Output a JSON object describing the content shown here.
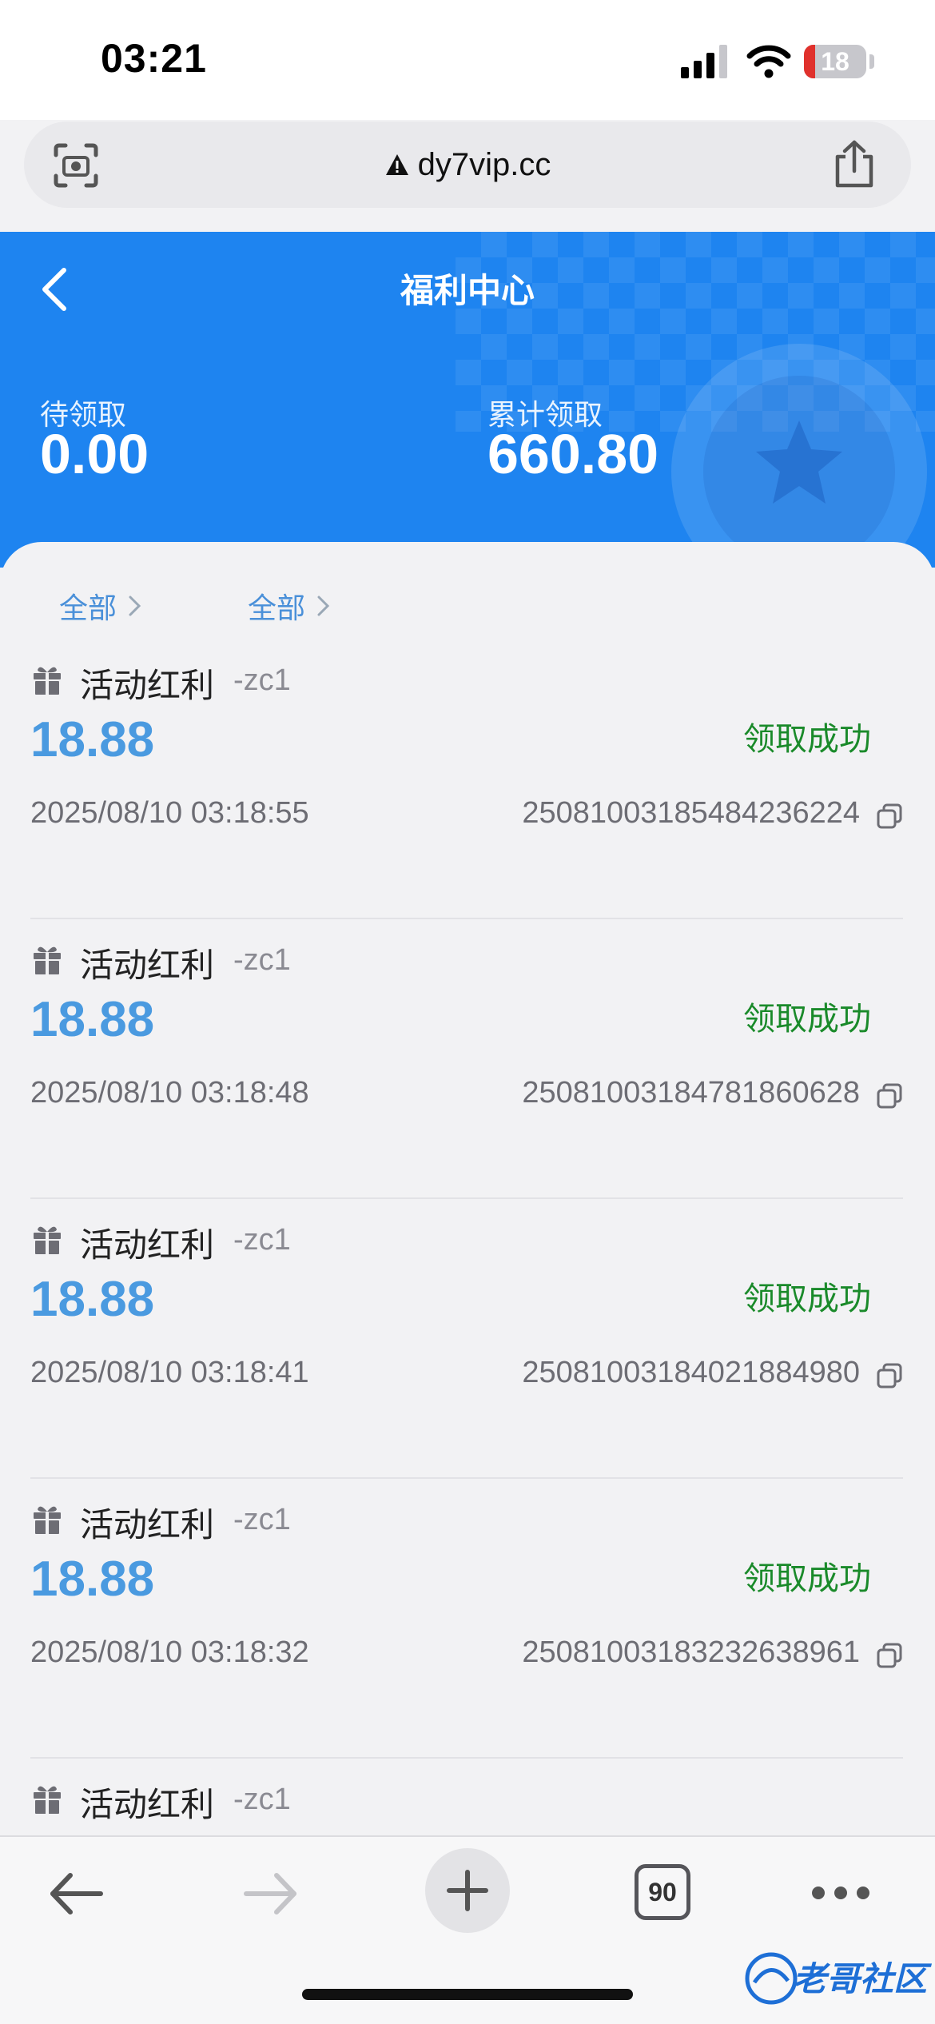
{
  "status_bar": {
    "time": "03:21",
    "battery_level": "18",
    "battery_fill_percent": 18,
    "icons": [
      "signal-icon",
      "wifi-icon",
      "battery-icon"
    ]
  },
  "browser": {
    "url": "dy7vip.cc",
    "icons": [
      "camera-search-icon",
      "warning-icon",
      "share-icon"
    ]
  },
  "header": {
    "title": "福利中心",
    "pending_label": "待领取",
    "pending_value": "0.00",
    "total_label": "累计领取",
    "total_value": "660.80",
    "accent_color": "#1e84f0"
  },
  "filters": [
    {
      "label": "全部"
    },
    {
      "label": "全部"
    }
  ],
  "records": [
    {
      "title": "活动红利",
      "tag": "-zc1",
      "amount": "18.88",
      "status": "领取成功",
      "time": "2025/08/10 03:18:55",
      "order_id": "25081003185484236224"
    },
    {
      "title": "活动红利",
      "tag": "-zc1",
      "amount": "18.88",
      "status": "领取成功",
      "time": "2025/08/10 03:18:48",
      "order_id": "25081003184781860628"
    },
    {
      "title": "活动红利",
      "tag": "-zc1",
      "amount": "18.88",
      "status": "领取成功",
      "time": "2025/08/10 03:18:41",
      "order_id": "25081003184021884980"
    },
    {
      "title": "活动红利",
      "tag": "-zc1",
      "amount": "18.88",
      "status": "领取成功",
      "time": "2025/08/10 03:18:32",
      "order_id": "25081003183232638961"
    },
    {
      "title": "活动红利",
      "tag": "-zc1"
    }
  ],
  "toolbar": {
    "tab_count": "90",
    "icons": [
      "back-arrow-icon",
      "forward-arrow-icon",
      "plus-icon",
      "tabs-icon",
      "more-icon"
    ]
  },
  "watermark": {
    "text": "老哥社区"
  },
  "colors": {
    "amount": "#4a9ae0",
    "status_success": "#1a8a2a",
    "filter": "#4a90d9"
  }
}
